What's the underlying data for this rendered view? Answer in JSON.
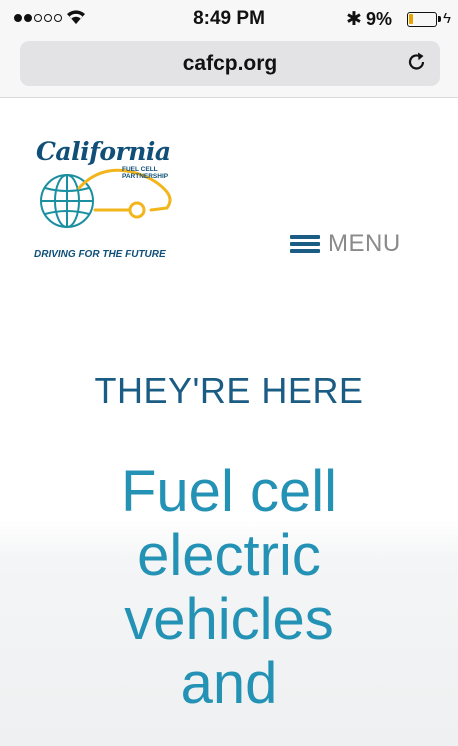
{
  "status_bar": {
    "time": "8:49 PM",
    "battery_percent": "9%",
    "bluetooth_icon": "bluetooth-icon",
    "signal_icon": "signal-dots-icon",
    "wifi_icon": "wifi-icon",
    "battery_icon": "battery-icon",
    "battery_level": 0.09
  },
  "browser": {
    "url": "cafcp.org",
    "reload_icon": "reload-icon"
  },
  "site": {
    "logo": {
      "title": "California",
      "sub_line1": "FUEL CELL",
      "sub_line2": "PARTNERSHIP",
      "tagline": "DRIVING FOR THE FUTURE"
    },
    "menu": {
      "icon": "hamburger-icon",
      "label": "MENU"
    }
  },
  "hero": {
    "subtitle": "THEY'RE HERE",
    "title_lines": [
      "Fuel cell",
      "electric",
      "vehicles",
      "and"
    ]
  },
  "colors": {
    "brand_dark_blue": "#1a5c84",
    "brand_teal": "#2492b4",
    "logo_yellow": "#f2b51b",
    "menu_gray": "#8a8a8a"
  }
}
